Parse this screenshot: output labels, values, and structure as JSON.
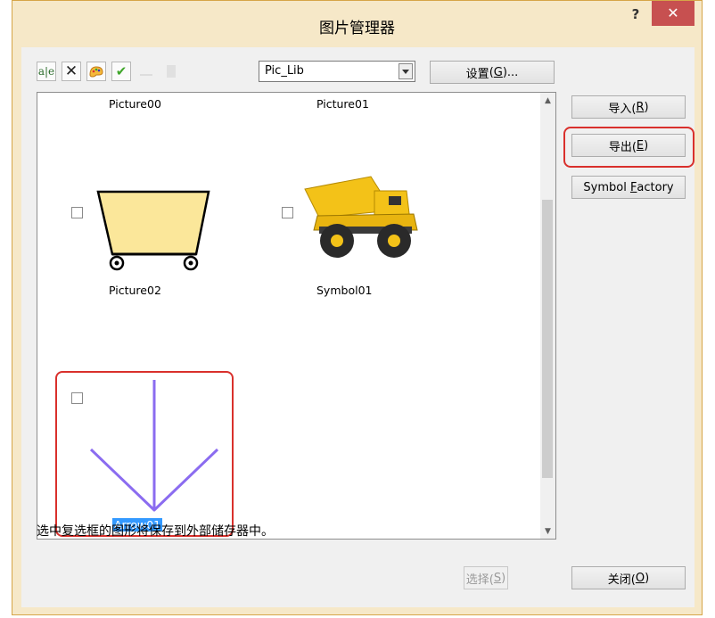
{
  "dialog": {
    "title": "图片管理器",
    "help_label": "?",
    "close_label": "✕"
  },
  "toolbar": {
    "combo_value": "Pic_Lib",
    "settings_label": "设置",
    "settings_key": "G",
    "settings_suffix": ")..."
  },
  "side_buttons": {
    "import_label": "导入(",
    "import_key": "R",
    "export_label": "导出(",
    "export_key": "E",
    "symbol_label_pre": "Symbol ",
    "symbol_key": "F",
    "symbol_label_post": "actory"
  },
  "list": {
    "items": [
      {
        "caption": "Picture00"
      },
      {
        "caption": "Picture01"
      },
      {
        "caption": "Picture02"
      },
      {
        "caption": "Symbol01"
      },
      {
        "caption": "Arrow01"
      }
    ]
  },
  "footer": {
    "status": "选中复选框的图形将保存到外部储存器中。",
    "select_label": "选择(",
    "select_key": "S",
    "close_label": "关闭(",
    "close_key": "O",
    "paren_close": ")"
  },
  "colors": {
    "title_bar": "#f6e8c8",
    "close_button": "#c75050",
    "highlight": "#d9302c",
    "selection": "#3399ff",
    "arrow": "#8b6cf0",
    "cart_fill": "#fbe79a",
    "truck": "#f3c218"
  },
  "icons": [
    "rename-icon",
    "delete-icon",
    "palette-icon",
    "check-icon",
    "blank-icon",
    "blank-icon-2",
    "dropdown-arrow-icon"
  ]
}
